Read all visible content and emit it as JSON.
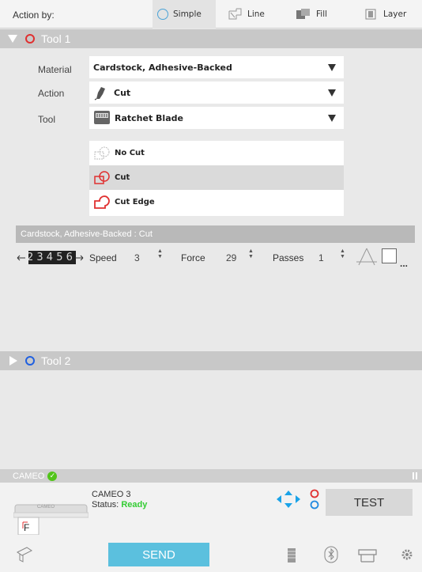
{
  "action_bar": {
    "label": "Action by:",
    "tabs": [
      {
        "label": "Simple",
        "selected": true
      },
      {
        "label": "Line",
        "selected": false
      },
      {
        "label": "Fill",
        "selected": false
      },
      {
        "label": "Layer",
        "selected": false
      }
    ]
  },
  "tool1": {
    "title": "Tool 1",
    "ring_color": "#e03030",
    "material_label": "Material",
    "material_value": "Cardstock, Adhesive-Backed",
    "action_label": "Action",
    "action_value": "Cut",
    "tool_label": "Tool",
    "tool_value": "Ratchet Blade",
    "cut_options": [
      {
        "label": "No Cut",
        "selected": false
      },
      {
        "label": "Cut",
        "selected": true
      },
      {
        "label": "Cut Edge",
        "selected": false
      }
    ],
    "settings_header": "Cardstock, Adhesive-Backed : Cut",
    "blade_strip": "2 3 4 5 6",
    "speed_label": "Speed",
    "speed_value": "3",
    "force_label": "Force",
    "force_value": "29",
    "passes_label": "Passes",
    "passes_value": "1",
    "more": "..."
  },
  "tool2": {
    "title": "Tool 2",
    "ring_color": "#2060e0"
  },
  "device": {
    "header_name": "CAMEO",
    "name": "CAMEO 3",
    "status_label": "Status:",
    "status_value": "Ready",
    "status_color": "#33cc33",
    "test_label": "TEST",
    "send_label": "SEND",
    "preview_letter": "F",
    "preview_brand": "CAMEO"
  },
  "colors": {
    "accent": "#5bc0de",
    "tool_header": "#c8c8c8"
  }
}
